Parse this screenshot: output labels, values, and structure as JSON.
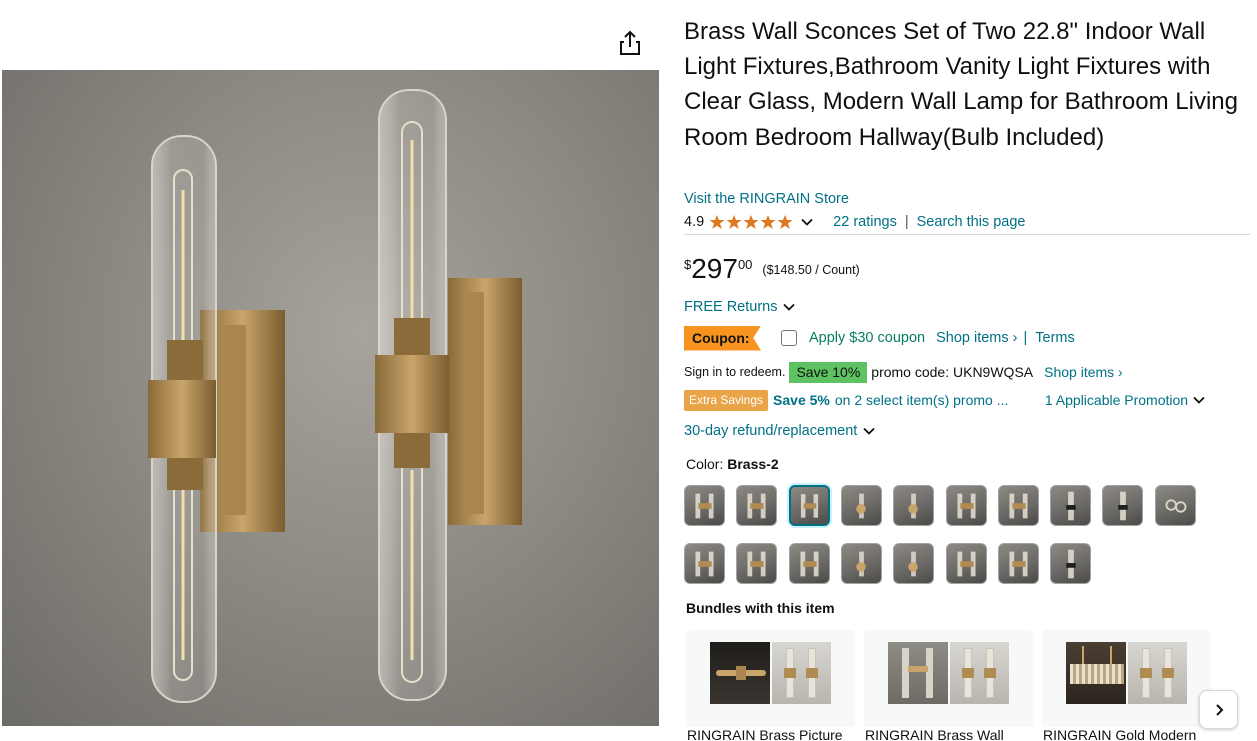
{
  "product": {
    "title": "Brass Wall Sconces Set of Two 22.8\" Indoor Wall Light Fixtures,Bathroom Vanity Light Fixtures with Clear Glass, Modern Wall Lamp for Bathroom Living Room Bedroom Hallway(Bulb Included)",
    "store_link": "Visit the RINGRAIN Store",
    "rating_value": "4.9",
    "stars_filled": 5,
    "ratings_count": "22 ratings",
    "search_link": "Search this page",
    "pipe": "|"
  },
  "price": {
    "symbol": "$",
    "whole": "297",
    "fraction": "00",
    "unit_price": "($148.50 / Count)"
  },
  "returns": {
    "free_returns": "FREE Returns"
  },
  "coupon": {
    "tag": "Coupon:",
    "apply_text": "Apply $30 coupon",
    "shop_items": "Shop items ›",
    "pipe": "|",
    "terms": "Terms"
  },
  "promo": {
    "sign_in": "Sign in to redeem.",
    "save_badge": "Save 10%",
    "promo_code": "promo code: UKN9WQSA",
    "shop_items": "Shop items ›"
  },
  "extra": {
    "badge": "Extra Savings",
    "save5": "Save 5%",
    "detail": "on 2 select item(s) promo ...",
    "applicable": "1 Applicable Promotion"
  },
  "refund": {
    "text": "30-day refund/replacement"
  },
  "color": {
    "label": "Color:",
    "selected": "Brass-2",
    "swatch_count": 18,
    "selected_index": 2
  },
  "bundles": {
    "label": "Bundles with this item",
    "items": [
      {
        "name": "RINGRAIN Brass Picture"
      },
      {
        "name": "RINGRAIN Brass Wall"
      },
      {
        "name": "RINGRAIN Gold Modern"
      }
    ]
  },
  "colors": {
    "link": "#007185",
    "green": "#067d62",
    "coupon_orange": "#f7931e",
    "save_green": "#5fc262",
    "star": "#de7921"
  },
  "icons": {
    "share": "share-icon",
    "star": "star-icon",
    "chevron": "chevron-down-icon",
    "next": "chevron-right-icon"
  }
}
